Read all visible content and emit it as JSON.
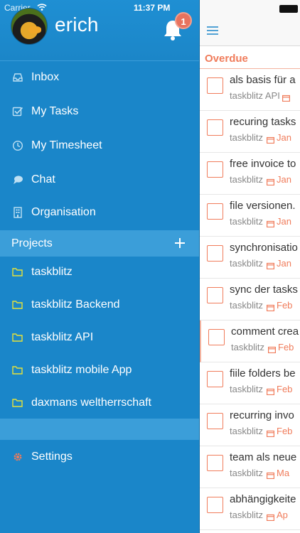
{
  "status_bar": {
    "carrier": "Carrier",
    "time": "11:37 PM"
  },
  "profile": {
    "username": "erich",
    "notification_count": "1"
  },
  "nav": [
    {
      "label": "Inbox",
      "icon": "inbox-icon"
    },
    {
      "label": "My Tasks",
      "icon": "checkbox-icon"
    },
    {
      "label": "My Timesheet",
      "icon": "clock-icon"
    },
    {
      "label": "Chat",
      "icon": "chat-bubble-icon"
    },
    {
      "label": "Organisation",
      "icon": "building-icon"
    }
  ],
  "projects": {
    "header": "Projects",
    "items": [
      {
        "label": "taskblitz"
      },
      {
        "label": "taskblitz Backend"
      },
      {
        "label": "taskblitz API"
      },
      {
        "label": "taskblitz mobile App"
      },
      {
        "label": "daxmans weltherrschaft"
      }
    ]
  },
  "settings": {
    "label": "Settings",
    "icon": "gear-icon"
  },
  "tasks": {
    "section": "Overdue",
    "items": [
      {
        "title": "als basis für a",
        "project": "taskblitz API",
        "due": ""
      },
      {
        "title": "recuring tasks",
        "project": "taskblitz",
        "due": "Jan"
      },
      {
        "title": "free invoice to",
        "project": "taskblitz",
        "due": "Jan"
      },
      {
        "title": "file versionen.",
        "project": "taskblitz",
        "due": "Jan"
      },
      {
        "title": "synchronisatio",
        "project": "taskblitz",
        "due": "Jan"
      },
      {
        "title": "sync der tasks",
        "project": "taskblitz",
        "due": "Feb"
      },
      {
        "title": "comment crea",
        "project": "taskblitz",
        "due": "Feb"
      },
      {
        "title": "fiile folders be",
        "project": "taskblitz",
        "due": "Feb"
      },
      {
        "title": "recurring invo",
        "project": "taskblitz",
        "due": "Feb"
      },
      {
        "title": "team als neue",
        "project": "taskblitz",
        "due": "Ma"
      },
      {
        "title": "abhängigkeite",
        "project": "taskblitz",
        "due": "Ap"
      }
    ]
  },
  "colors": {
    "sidebar": "#1a86c9",
    "highlight": "#3b9ed9",
    "overdue": "#f07c5b",
    "folder": "#e6e23a",
    "gear": "#f07c5b"
  }
}
